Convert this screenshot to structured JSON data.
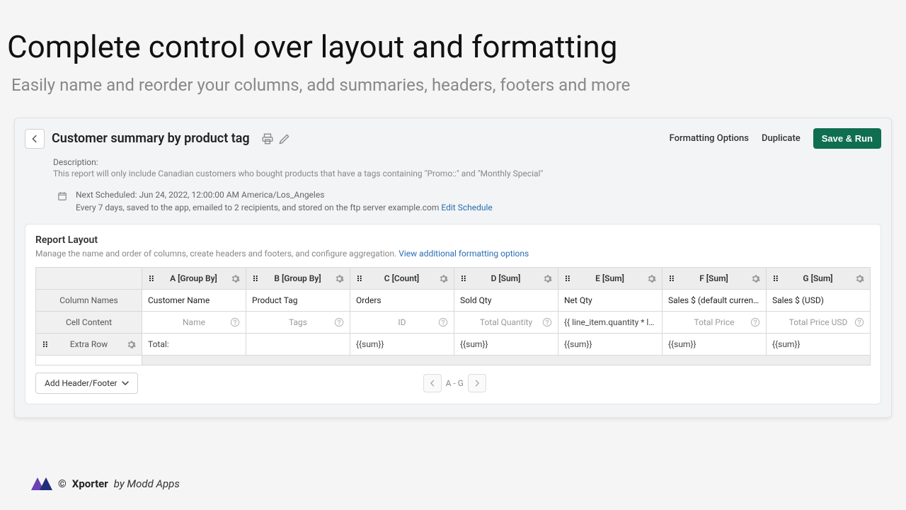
{
  "page": {
    "title": "Complete control over layout and formatting",
    "subtitle": "Easily name and reorder your columns, add summaries, headers, footers and more"
  },
  "report": {
    "back": "←",
    "title": "Customer summary by product tag",
    "actions": {
      "formatting": "Formatting Options",
      "duplicate": "Duplicate",
      "save_run": "Save & Run"
    },
    "description_label": "Description:",
    "description_text": "This report will only include Canadian customers who bought products that have a tags containing \"Promo::\" and \"Monthly Special\"",
    "schedule": {
      "next": "Next Scheduled: Jun 24, 2022, 12:00:00 AM America/Los_Angeles",
      "detail": "Every 7 days, saved to the app, emailed to 2 recipients, and stored on the ftp server example.com",
      "edit": "Edit Schedule"
    }
  },
  "layout": {
    "title": "Report Layout",
    "subtitle": "Manage the name and order of columns, create headers and footers, and configure aggregation.",
    "view_more": "View additional formatting options",
    "row_labels": {
      "column_names": "Column Names",
      "cell_content": "Cell Content",
      "extra_row": "Extra Row"
    },
    "columns": [
      {
        "head": "A [Group By]",
        "name": "Customer Name",
        "content": "Name",
        "extra": "Total:"
      },
      {
        "head": "B [Group By]",
        "name": "Product Tag",
        "content": "Tags",
        "extra": ""
      },
      {
        "head": "C [Count]",
        "name": "Orders",
        "content": "ID",
        "extra": "{{sum}}"
      },
      {
        "head": "D [Sum]",
        "name": "Sold Qty",
        "content": "Total Quantity",
        "extra": "{{sum}}"
      },
      {
        "head": "E [Sum]",
        "name": "Net Qty",
        "content": "{{ line_item.quantity * line_it",
        "extra": "{{sum}}"
      },
      {
        "head": "F [Sum]",
        "name": "Sales $ (default currency)",
        "content": "Total Price",
        "extra": "{{sum}}"
      },
      {
        "head": "G [Sum]",
        "name": "Sales $ (USD)",
        "content": "Total Price USD",
        "extra": "{{sum}}"
      }
    ],
    "add_header_footer": "Add Header/Footer",
    "pager_range": "A - G"
  },
  "brand": {
    "copyright": "©",
    "name": "Xporter",
    "by": "by Modd Apps"
  }
}
